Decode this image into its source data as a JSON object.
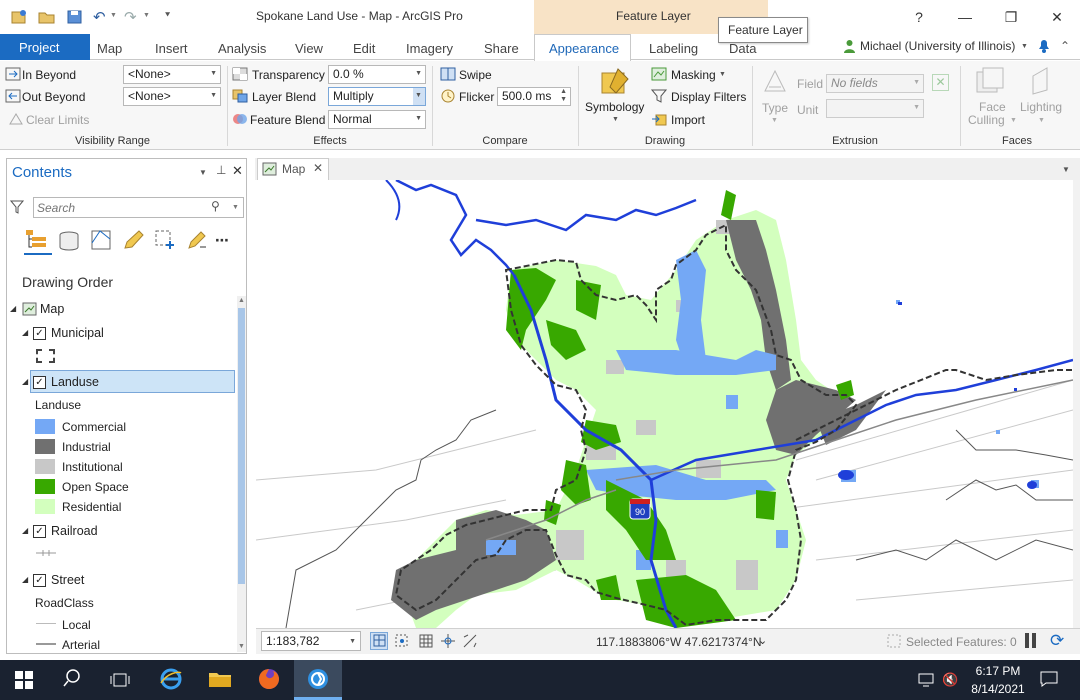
{
  "window": {
    "title": "Spokane Land Use - Map - ArcGIS Pro",
    "context_title": "Feature Layer",
    "tooltip": "Feature Layer",
    "help": "?",
    "user": "Michael (University of Illinois)"
  },
  "tabs": {
    "project": "Project",
    "items": [
      "Map",
      "Insert",
      "Analysis",
      "View",
      "Edit",
      "Imagery",
      "Share"
    ],
    "appearance": "Appearance",
    "labeling": "Labeling",
    "data": "Data"
  },
  "ribbon": {
    "visibility": {
      "in_beyond": "In Beyond",
      "out_beyond": "Out Beyond",
      "clear_limits": "Clear Limits",
      "in_value": "<None>",
      "out_value": "<None>",
      "group": "Visibility Range"
    },
    "effects": {
      "transparency": "Transparency",
      "transparency_value": "0.0 %",
      "layer_blend": "Layer Blend",
      "layer_blend_value": "Multiply",
      "feature_blend": "Feature Blend",
      "feature_blend_value": "Normal",
      "group": "Effects"
    },
    "compare": {
      "swipe": "Swipe",
      "flicker": "Flicker",
      "flicker_value": "500.0",
      "flicker_unit": "ms",
      "group": "Compare"
    },
    "drawing": {
      "symbology": "Symbology",
      "masking": "Masking",
      "display_filters": "Display Filters",
      "import": "Import",
      "group": "Drawing"
    },
    "extrusion": {
      "type": "Type",
      "field": "Field",
      "field_value": "No fields",
      "unit": "Unit",
      "group": "Extrusion"
    },
    "faces": {
      "face_culling_1": "Face",
      "face_culling_2": "Culling",
      "lighting": "Lighting",
      "group": "Faces"
    }
  },
  "contents": {
    "title": "Contents",
    "search_placeholder": "Search",
    "drawing_order": "Drawing Order",
    "map": "Map",
    "municipal": "Municipal",
    "landuse": "Landuse",
    "landuse_heading": "Landuse",
    "legend": [
      {
        "label": "Commercial",
        "color": "#74a8f5"
      },
      {
        "label": "Industrial",
        "color": "#707070"
      },
      {
        "label": "Institutional",
        "color": "#c8c8c8"
      },
      {
        "label": "Open Space",
        "color": "#38a800"
      },
      {
        "label": "Residential",
        "color": "#d3ffbe"
      }
    ],
    "railroad": "Railroad",
    "street": "Street",
    "roadclass": "RoadClass",
    "road_items": [
      "Local",
      "Arterial"
    ]
  },
  "map": {
    "tab": "Map",
    "scale": "1:183,782",
    "coords": "117.1883806°W 47.6217374°N",
    "selected": "Selected Features: 0",
    "shield": "90"
  },
  "taskbar": {
    "time": "6:17 PM",
    "date": "8/14/2021"
  }
}
